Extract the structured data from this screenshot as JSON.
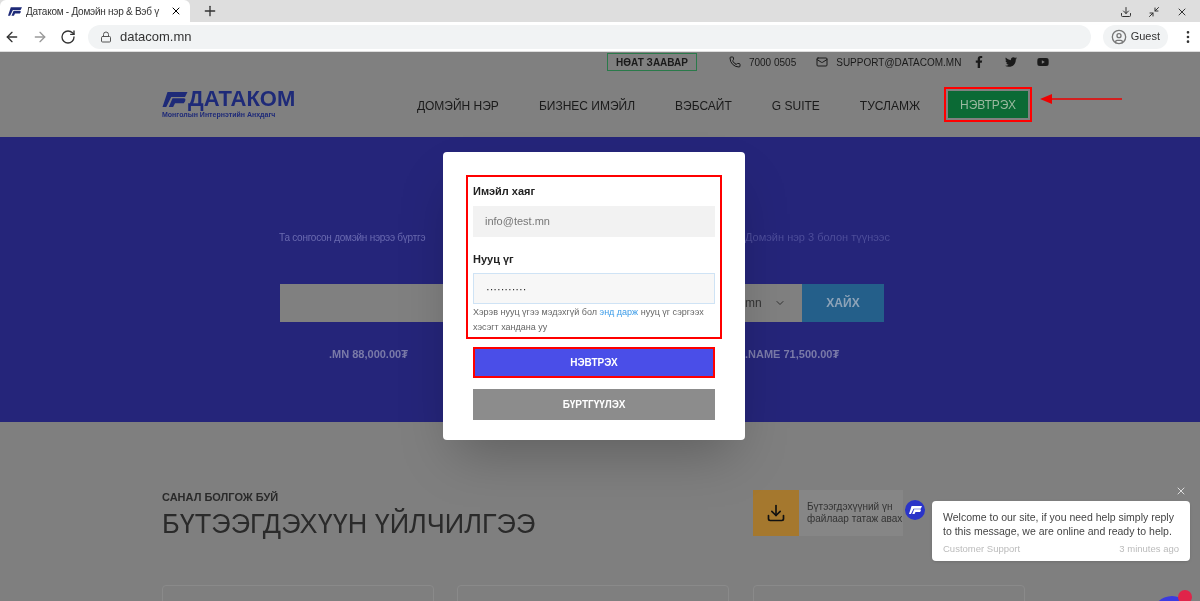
{
  "browser": {
    "tab_title": "Датаком - Домэйн нэр & Вэб ү",
    "url": "datacom.mn",
    "profile": "Guest"
  },
  "topbar": {
    "vat_button": "НӨАТ ЗААВАР",
    "phone": "7000 0505",
    "email": "SUPPORT@DATACOM.MN"
  },
  "header": {
    "logo": "ДАТАКОМ",
    "tagline": "Монголын Интернэтийн Анхдагч",
    "nav": [
      {
        "label": "ДОМЭЙН НЭР",
        "kind": "link",
        "highlighted": false
      },
      {
        "label": "БИЗНЕС ИМЭЙЛ",
        "kind": "link",
        "highlighted": false
      },
      {
        "label": "ВЭБСАЙТ",
        "kind": "link",
        "highlighted": false
      },
      {
        "label": "G SUITE",
        "kind": "link",
        "highlighted": false
      },
      {
        "label": "ТУСЛАМЖ",
        "kind": "link",
        "highlighted": false
      },
      {
        "label": "НЭВТРЭХ",
        "kind": "button",
        "highlighted": true
      }
    ],
    "arrow_pointer": true
  },
  "hero": {
    "subtitle_left": "Та сонгосон домэйн нэрээ бүртгэ",
    "subtitle_right": "Домэйн нэр 3 болон түүнээс",
    "select_value": "mn",
    "search_button": "ХАЙХ",
    "price_left": ".MN 88,000.00₮",
    "price_right": ".NAME 71,500.00₮"
  },
  "products": {
    "eyebrow": "САНАЛ БОЛГОЖ БУЙ",
    "title": "БҮТЭЭГДЭХҮҮН ҮЙЛЧИЛГЭЭ",
    "download_line1": "Бүтээгдэхүүний үн",
    "download_line2": "файлаар татаж авах"
  },
  "login_modal": {
    "form_highlighted": true,
    "email_label": "Имэйл хаяг",
    "email_placeholder": "info@test.mn",
    "password_label": "Нууц үг",
    "password_value": "···········",
    "help_before": "Хэрэв нууц үгээ мэдэхгүй бол",
    "help_link": "энд дарж",
    "help_after": "нууц үг сэргээх хэсэгт хандана уу",
    "buttons": [
      {
        "label": "НЭВТРЭХ",
        "kind": "primary",
        "highlighted": true
      },
      {
        "label": "БҮРТГҮҮЛЭХ",
        "kind": "secondary",
        "highlighted": false
      }
    ]
  },
  "chat": {
    "message": "Welcome to our site, if you need help simply reply to this message, we are online and ready to help.",
    "sender": "Customer Support",
    "time": "3 minutes ago"
  }
}
